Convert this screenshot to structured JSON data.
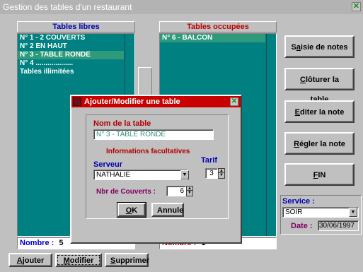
{
  "window": {
    "title": "Gestion des tables d'un restaurant"
  },
  "free_tables": {
    "header": "Tables libres",
    "items": [
      "N° 1 - 2 COUVERTS",
      "N° 2 EN HAUT",
      "N° 3 - TABLE RONDE",
      "N° 4 ...................",
      "Tables illimitées"
    ],
    "selected_index": 2,
    "count_label": "Nombre :",
    "count_value": "5"
  },
  "occupied_tables": {
    "header": "Tables occupées",
    "items": [
      "N° 6 - BALCON"
    ],
    "count_label": "Nombre :",
    "count_value": "1"
  },
  "side_buttons": {
    "saisie_pre": "S",
    "saisie_ul": "a",
    "saisie_post": "isie de notes",
    "cloturer_ul": "C",
    "cloturer_post": "lôturer la table",
    "editer_ul": "E",
    "editer_post": "diter la note",
    "regler_ul": "R",
    "regler_post": "égler la note",
    "fin_ul": "F",
    "fin_post": "IN"
  },
  "service": {
    "label": "Service :",
    "value": "SOIR",
    "date_label": "Date :",
    "date_value": "30/06/1997"
  },
  "bottom_buttons": {
    "ajouter_ul": "A",
    "ajouter_post": "jouter",
    "modifier_ul": "M",
    "modifier_post": "odifier",
    "supprimer_ul": "S",
    "supprimer_post": "upprimer"
  },
  "dialog": {
    "title": "Ajouter/Modifier une table",
    "name_label": "Nom de la table",
    "name_value": "N° 3 - TABLE RONDE",
    "optional_label": "Informations facultatives",
    "server_label": "Serveur",
    "server_value": "NATHALIE",
    "tarif_label": "Tarif",
    "tarif_value": "3",
    "covers_label": "Nbr de Couverts :",
    "covers_value": "6",
    "ok_ul": "O",
    "ok_post": "K",
    "annule_label": "Annule"
  },
  "colors": {
    "list_bg": "#008080",
    "list_selected": "#2f9a7b",
    "dialog_title": "#c80000"
  }
}
